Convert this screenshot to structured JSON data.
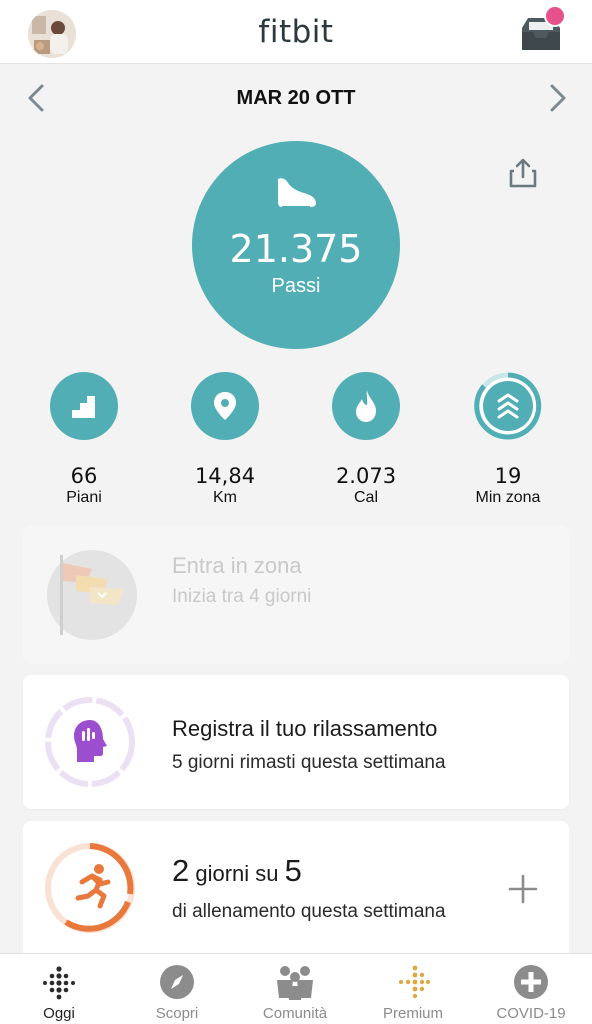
{
  "header": {
    "logo": "fitbit",
    "has_notification": true
  },
  "colors": {
    "teal": "#52aeb5",
    "purple": "#9b4fcf",
    "orange": "#e8783c",
    "notification": "#e8528c",
    "premium": "#e0a640"
  },
  "date_nav": {
    "title": "MAR 20 OTT"
  },
  "steps": {
    "value": "21.375",
    "label": "Passi",
    "icon": "shoe-icon"
  },
  "stats": [
    {
      "value": "66",
      "label": "Piani",
      "icon": "stairs-icon"
    },
    {
      "value": "14,84",
      "label": "Km",
      "icon": "location-pin-icon"
    },
    {
      "value": "2.073",
      "label": "Cal",
      "icon": "flame-icon"
    },
    {
      "value": "19",
      "label": "Min zona",
      "icon": "zone-chevrons-icon"
    }
  ],
  "cards": {
    "zone": {
      "title": "Entra in zona",
      "subtitle": "Inizia tra 4 giorni",
      "icon": "flags-icon"
    },
    "relax": {
      "title": "Registra il tuo rilassamento",
      "subtitle": "5 giorni rimasti questa settimana",
      "icon": "mind-head-icon"
    },
    "workout": {
      "count": "2",
      "count_mid": " giorni su ",
      "total": "5",
      "subtitle": "di allenamento questa settimana",
      "icon": "runner-icon"
    }
  },
  "bottom_nav": [
    {
      "label": "Oggi",
      "icon": "dots-grid-icon",
      "active": true
    },
    {
      "label": "Scopri",
      "icon": "compass-icon",
      "active": false
    },
    {
      "label": "Comunità",
      "icon": "community-icon",
      "active": false
    },
    {
      "label": "Premium",
      "icon": "premium-dots-icon",
      "active": false
    },
    {
      "label": "COVID-19",
      "icon": "plus-circle-icon",
      "active": false
    }
  ]
}
